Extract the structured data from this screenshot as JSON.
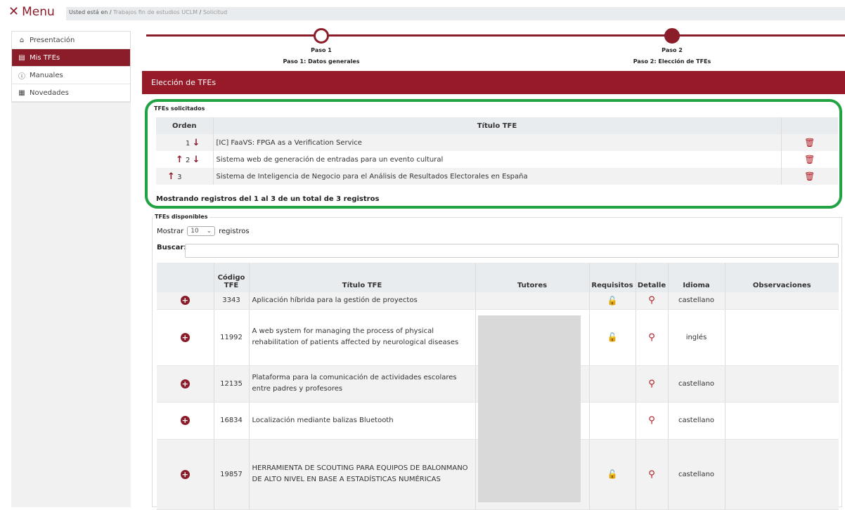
{
  "menu": {
    "label": "Menu"
  },
  "breadcrumb": {
    "prefix": "Usted está en /",
    "link1": "Trabajos fin de estudios UCLM",
    "sep": "/",
    "current": "Solicitud"
  },
  "sidebar": {
    "items": [
      {
        "label": "Presentación",
        "icon": "home-icon"
      },
      {
        "label": "Mis TFEs",
        "icon": "document-icon",
        "active": true
      },
      {
        "label": "Manuales",
        "icon": "info-icon"
      },
      {
        "label": "Novedades",
        "icon": "news-icon"
      }
    ]
  },
  "steps": [
    {
      "num": "Paso 1",
      "label": "Paso 1: Datos generales"
    },
    {
      "num": "Paso 2",
      "label": "Paso 2: Elección de TFEs"
    }
  ],
  "panel": {
    "title": "Elección de TFEs"
  },
  "requested": {
    "legend": "TFEs solicitados",
    "headers": {
      "order": "Orden",
      "title": "Título TFE"
    },
    "rows": [
      {
        "order": "1",
        "title": "[IC] FaaVS: FPGA as a Verification Service"
      },
      {
        "order": "2",
        "title": "Sistema web de generación de entradas para un evento cultural"
      },
      {
        "order": "3",
        "title": "Sistema de Inteligencia de Negocio para el Análisis de Resultados Electorales en España"
      }
    ],
    "info": "Mostrando registros del 1 al 3 de un total de 3 registros"
  },
  "available": {
    "legend": "TFEs disponibles",
    "show_label": "Mostrar",
    "show_value": "10",
    "records_label": "registros",
    "search_label": "Buscar:",
    "headers": {
      "code": "Código TFE",
      "title": "Título TFE",
      "tutors": "Tutores",
      "req": "Requisitos",
      "detail": "Detalle",
      "lang": "Idioma",
      "obs": "Observaciones"
    },
    "rows": [
      {
        "code": "3343",
        "title": "Aplicación híbrida para la gestión de proyectos",
        "lang": "castellano",
        "lock": true
      },
      {
        "code": "11992",
        "title": "A web system for managing the process of physical rehabilitation of patients affected by neurological diseases",
        "lang": "inglés",
        "lock": true
      },
      {
        "code": "12135",
        "title": "Plataforma para la comunicación de actividades escolares entre padres y profesores",
        "lang": "castellano",
        "lock": false
      },
      {
        "code": "16834",
        "title": "Localización mediante balizas Bluetooth",
        "lang": "castellano",
        "lock": false
      },
      {
        "code": "19857",
        "title": "HERRAMIENTA DE SCOUTING PARA EQUIPOS DE BALONMANO DE ALTO NIVEL EN BASE A ESTADÍSTICAS NUMÉRICAS",
        "lang": "castellano",
        "lock": true
      }
    ]
  },
  "colors": {
    "brand": "#971a28",
    "highlight": "#21a343"
  }
}
